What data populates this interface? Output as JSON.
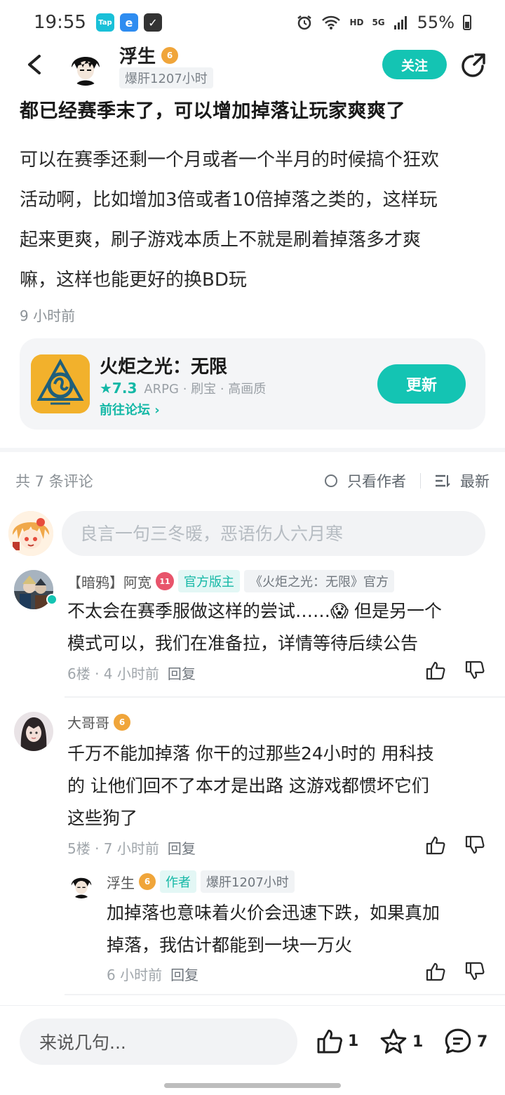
{
  "status_bar": {
    "time": "19:55",
    "app_icons": [
      "Tap",
      "e",
      "✓"
    ],
    "hd": "HD",
    "network": "5G",
    "battery": "55%"
  },
  "header": {
    "author_name": "浮生",
    "level": "6",
    "author_tag": "爆肝1207小时",
    "follow_label": "关注"
  },
  "post": {
    "title": "都已经赛季末了，可以增加掉落让玩家爽爽了",
    "body_lines": [
      "可以在赛季还剩一个月或者一个半月的时候搞个狂欢",
      "活动啊，比如增加3倍或者10倍掉落之类的，这样玩",
      "起来更爽，刷子游戏本质上不就是刷着掉落多才爽",
      "嘛，这样也能更好的换BD玩"
    ],
    "time": "9 小时前"
  },
  "game_card": {
    "name": "火炬之光：无限",
    "score": "★7.3",
    "tags": "ARPG · 刷宝 · 高画质",
    "forum_link": "前往论坛 ›",
    "update_label": "更新"
  },
  "comments_header": {
    "count": "共 7 条评论",
    "author_only": "只看作者",
    "sort": "最新"
  },
  "reply_box": {
    "placeholder": "良言一句三冬暖，恶语伤人六月寒"
  },
  "comments": [
    {
      "name": "【暗鸦】阿宽",
      "level": "11",
      "tag1": "官方版主",
      "tag2": "《火炬之光：无限》官方",
      "text_lines": [
        "不太会在赛季服做这样的尝试……😱 但是另一个",
        "模式可以，我们在准备拉，详情等待后续公告"
      ],
      "floor": "6楼 · 4 小时前",
      "reply": "回复"
    },
    {
      "name": "大哥哥",
      "level": "6",
      "text_lines": [
        "千万不能加掉落  你干的过那些24小时的  用科技",
        "的    让他们回不了本才是出路  这游戏都惯坏它们",
        "这些狗了"
      ],
      "floor": "5楼 · 7 小时前",
      "reply": "回复"
    }
  ],
  "sub_reply": {
    "name": "浮生",
    "level": "6",
    "role": "作者",
    "tag": "爆肝1207小时",
    "text_lines": [
      "加掉落也意味着火价会迅速下跌，如果真加",
      "掉落，我估计都能到一块一万火"
    ],
    "time": "6 小时前",
    "reply": "回复"
  },
  "bottom_bar": {
    "input_label": "来说几句...",
    "likes": "1",
    "favorites": "1",
    "comments": "7"
  }
}
